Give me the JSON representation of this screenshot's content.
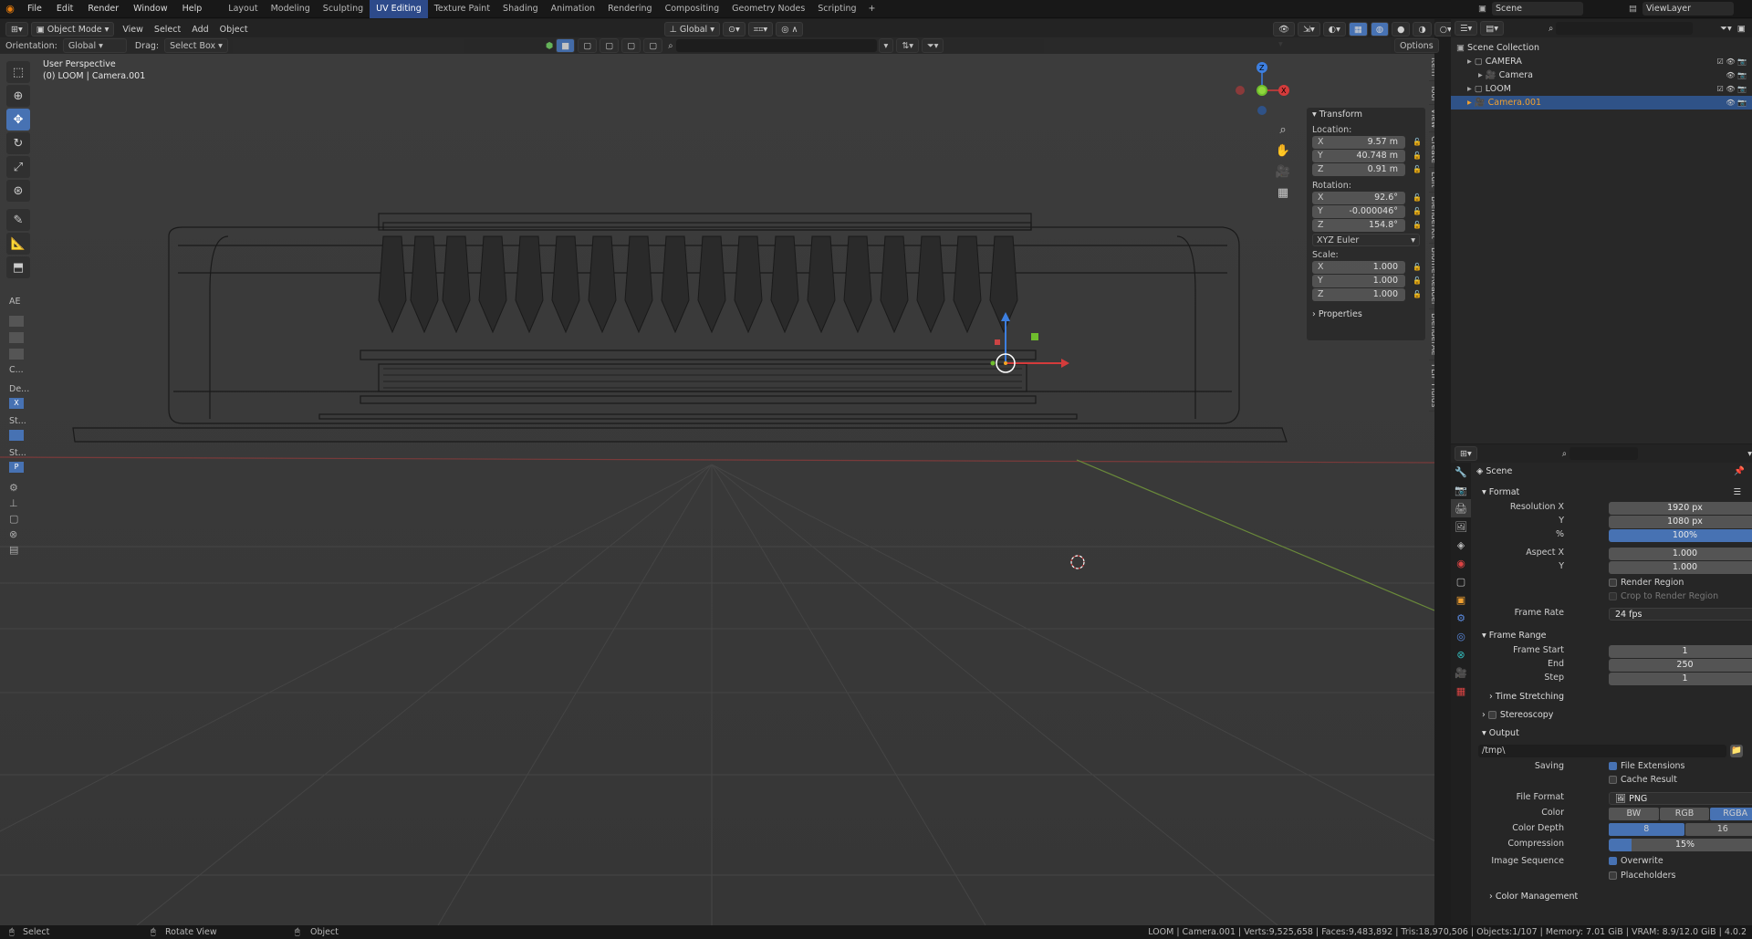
{
  "menu": {
    "file": "File",
    "edit": "Edit",
    "render": "Render",
    "window": "Window",
    "help": "Help"
  },
  "workspaces": [
    "Layout",
    "Modeling",
    "Sculpting",
    "UV Editing",
    "Texture Paint",
    "Shading",
    "Animation",
    "Rendering",
    "Compositing",
    "Geometry Nodes",
    "Scripting"
  ],
  "active_workspace": "UV Editing",
  "scene_name": "Scene",
  "view_layer": "ViewLayer",
  "header": {
    "mode": "Object Mode",
    "view": "View",
    "select": "Select",
    "add": "Add",
    "object": "Object",
    "transform_orientation": "Global",
    "orientation_label": "Orientation:",
    "orientation_value": "Global",
    "drag_label": "Drag:",
    "drag_value": "Select Box",
    "options": "Options"
  },
  "viewport": {
    "perspective": "User Perspective",
    "object_info": "(0) LOOM | Camera.001"
  },
  "left_tool_labels": [
    "AE",
    "C...",
    "De...",
    "St...",
    "St..."
  ],
  "transform_panel": {
    "title": "Transform",
    "location_label": "Location:",
    "location": [
      {
        "axis": "X",
        "value": "9.57 m"
      },
      {
        "axis": "Y",
        "value": "40.748 m"
      },
      {
        "axis": "Z",
        "value": "0.91 m"
      }
    ],
    "rotation_label": "Rotation:",
    "rotation": [
      {
        "axis": "X",
        "value": "92.6°"
      },
      {
        "axis": "Y",
        "value": "-0.000046°"
      },
      {
        "axis": "Z",
        "value": "154.8°"
      }
    ],
    "rotation_mode": "XYZ Euler",
    "scale_label": "Scale:",
    "scale": [
      {
        "axis": "X",
        "value": "1.000"
      },
      {
        "axis": "Y",
        "value": "1.000"
      },
      {
        "axis": "Z",
        "value": "1.000"
      }
    ],
    "properties": "Properties"
  },
  "side_tabs": [
    "Item",
    "Tool",
    "View",
    "Create",
    "Edit",
    "BlenderKit",
    "Biome-Reader",
    "BlenderAe",
    "FLIP Fluids"
  ],
  "outliner": {
    "rows": [
      {
        "label": "Scene Collection",
        "indent": 0
      },
      {
        "label": "CAMERA",
        "indent": 1
      },
      {
        "label": "Camera",
        "indent": 2
      },
      {
        "label": "LOOM",
        "indent": 1
      },
      {
        "label": "Camera.001",
        "indent": 1
      }
    ]
  },
  "properties": {
    "context": "Scene",
    "format": {
      "title": "Format",
      "resolution_x_label": "Resolution X",
      "resolution_x": "1920 px",
      "resolution_y_label": "Y",
      "resolution_y": "1080 px",
      "percent_label": "%",
      "percent": "100%",
      "aspect_x_label": "Aspect X",
      "aspect_x": "1.000",
      "aspect_y_label": "Y",
      "aspect_y": "1.000",
      "render_region": "Render Region",
      "crop_region": "Crop to Render Region",
      "frame_rate_label": "Frame Rate",
      "frame_rate": "24 fps"
    },
    "frame_range": {
      "title": "Frame Range",
      "start_label": "Frame Start",
      "start": "1",
      "end_label": "End",
      "end": "250",
      "step_label": "Step",
      "step": "1",
      "time_stretching": "Time Stretching"
    },
    "stereoscopy": "Stereoscopy",
    "output": {
      "title": "Output",
      "path": "/tmp\\",
      "saving_label": "Saving",
      "file_extensions": "File Extensions",
      "cache_result": "Cache Result",
      "file_format_label": "File Format",
      "file_format": "PNG",
      "color_label": "Color",
      "color_options": [
        "BW",
        "RGB",
        "RGBA"
      ],
      "color_selected": "RGBA",
      "depth_label": "Color Depth",
      "depth_options": [
        "8",
        "16"
      ],
      "compression_label": "Compression",
      "compression": "15%",
      "compression_fraction": 0.15,
      "image_sequence_label": "Image Sequence",
      "overwrite": "Overwrite",
      "placeholders": "Placeholders",
      "color_management": "Color Management"
    }
  },
  "status": {
    "select": "Select",
    "rotate": "Rotate View",
    "object": "Object",
    "stats": "LOOM | Camera.001 | Verts:9,525,658 | Faces:9,483,892 | Tris:18,970,506 | Objects:1/107 | Memory: 7.01 GiB | VRAM: 8.9/12.0 GiB | 4.0.2"
  }
}
